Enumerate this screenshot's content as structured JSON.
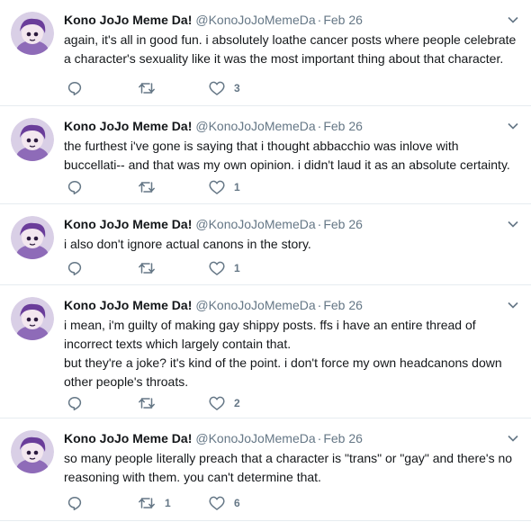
{
  "tweets": [
    {
      "name": "Kono JoJo Meme Da!",
      "handle": "@KonoJoJoMemeDa",
      "dot": "·",
      "time": "Feb 26",
      "text": "again, it's all in good fun. i absolutely loathe cancer posts where people celebrate\na character's sexuality like it was the most important thing about that character.",
      "retweets": "",
      "likes": "3"
    },
    {
      "name": "Kono JoJo Meme Da!",
      "handle": "@KonoJoJoMemeDa",
      "dot": "·",
      "time": "Feb 26",
      "text": "the furthest i've gone is saying that i thought abbacchio was inlove with\nbuccellati-- and that was my own opinion. i didn't laud it as an absolute certainty.",
      "retweets": "",
      "likes": "1"
    },
    {
      "name": "Kono JoJo Meme Da!",
      "handle": "@KonoJoJoMemeDa",
      "dot": "·",
      "time": "Feb 26",
      "text": "i also don't ignore actual canons in the story.",
      "retweets": "",
      "likes": "1"
    },
    {
      "name": "Kono JoJo Meme Da!",
      "handle": "@KonoJoJoMemeDa",
      "dot": "·",
      "time": "Feb 26",
      "text": "i mean, i'm guilty of making gay shippy posts. ffs i have an entire thread of\nincorrect texts which largely contain that.\nbut they're a joke? it's kind of the point. i don't force my own headcanons down\nother people's throats.",
      "retweets": "",
      "likes": "2"
    },
    {
      "name": "Kono JoJo Meme Da!",
      "handle": "@KonoJoJoMemeDa",
      "dot": "·",
      "time": "Feb 26",
      "text": "so many people literally preach that a character is \"trans\" or \"gay\" and there's no\nreasoning with them. you can't determine that.",
      "retweets": "1",
      "likes": "6"
    }
  ],
  "colors": {
    "text": "#14171a",
    "muted": "#657786",
    "border": "#e6ecf0",
    "avatar_bg": "#b89ad6",
    "avatar_hair": "#6a3d9a"
  },
  "icons": [
    "reply-icon",
    "retweet-icon",
    "like-icon",
    "caret-down-icon",
    "avatar"
  ]
}
